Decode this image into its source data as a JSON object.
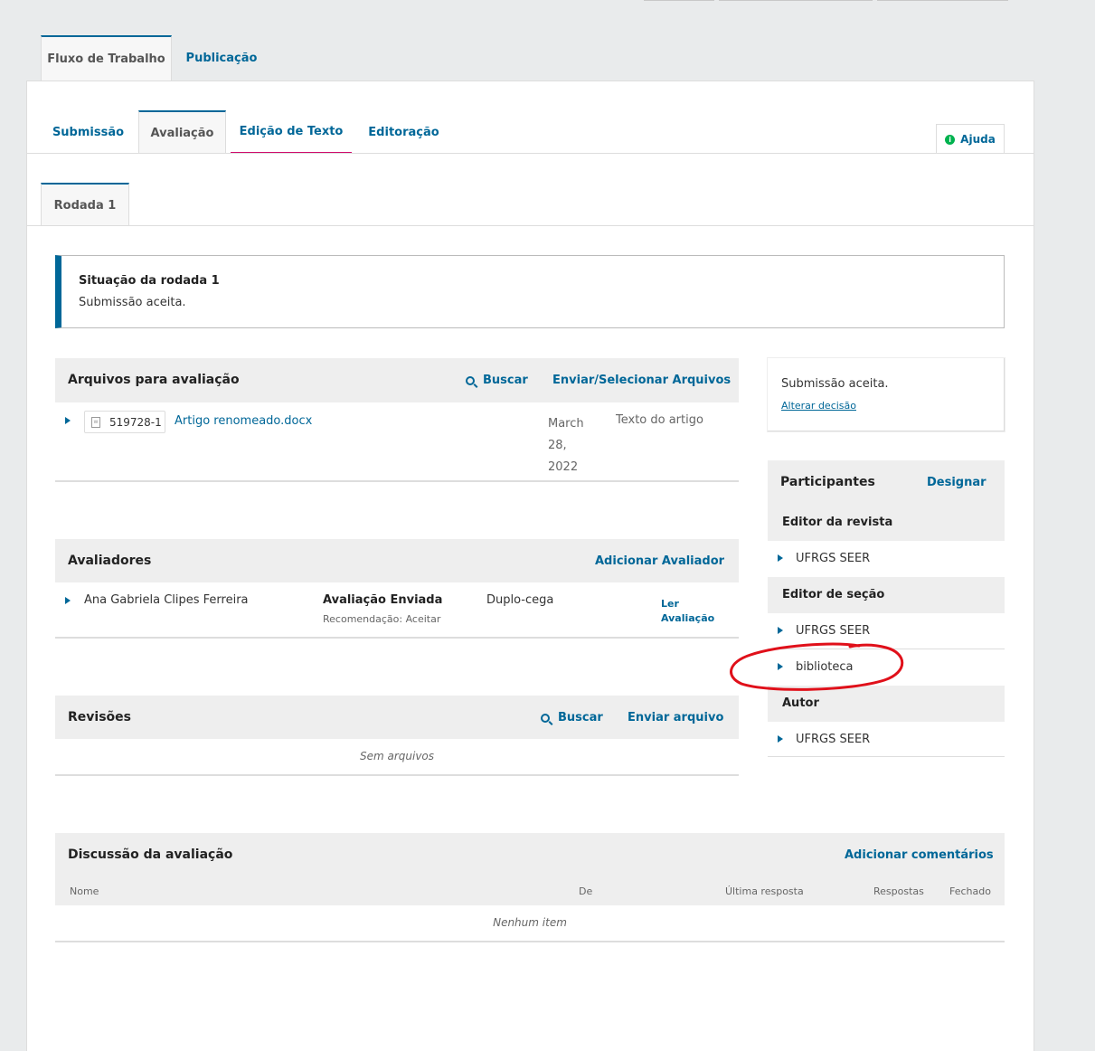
{
  "main_tabs": [
    {
      "label": "Fluxo de Trabalho"
    },
    {
      "label": "Publicação"
    }
  ],
  "stage_tabs": [
    {
      "label": "Submissão"
    },
    {
      "label": "Avaliação"
    },
    {
      "label": "Edição de Texto"
    },
    {
      "label": "Editoração"
    }
  ],
  "help_label": "Ajuda",
  "round_tab": "Rodada 1",
  "round_status": {
    "title": "Situação da rodada 1",
    "text": "Submissão aceita."
  },
  "review_files": {
    "title": "Arquivos para avaliação",
    "search_label": "Buscar",
    "upload_label": "Enviar/Selecionar Arquivos",
    "row": {
      "id": "519728-1",
      "name": "Artigo renomeado.docx",
      "date_line1": "March",
      "date_line2": "28,",
      "date_line3": "2022",
      "type": "Texto do artigo"
    }
  },
  "reviewers": {
    "title": "Avaliadores",
    "add_label": "Adicionar Avaliador",
    "row": {
      "name": "Ana Gabriela Clipes Ferreira",
      "status": "Avaliação Enviada",
      "recommendation": "Recomendação: Aceitar",
      "method": "Duplo-cega",
      "action_line1": "Ler",
      "action_line2": "Avaliação"
    }
  },
  "revisions": {
    "title": "Revisões",
    "search_label": "Buscar",
    "upload_label": "Enviar arquivo",
    "empty": "Sem arquivos"
  },
  "decision": {
    "text": "Submissão aceita.",
    "change_label": "Alterar decisão"
  },
  "participants": {
    "title": "Participantes",
    "assign_label": "Designar",
    "groups": [
      {
        "role": "Editor da revista",
        "members": [
          "UFRGS SEER"
        ]
      },
      {
        "role": "Editor de seção",
        "members": [
          "UFRGS SEER",
          "biblioteca"
        ]
      },
      {
        "role": "Autor",
        "members": [
          "UFRGS SEER"
        ]
      }
    ]
  },
  "discussion": {
    "title": "Discussão da avaliação",
    "add_label": "Adicionar comentários",
    "columns": [
      "Nome",
      "De",
      "Última resposta",
      "Respostas",
      "Fechado"
    ],
    "empty": "Nenhum item"
  },
  "colors": {
    "accent": "#006798",
    "annotation": "#e0101a",
    "editing_underline": "#d00a6c"
  }
}
